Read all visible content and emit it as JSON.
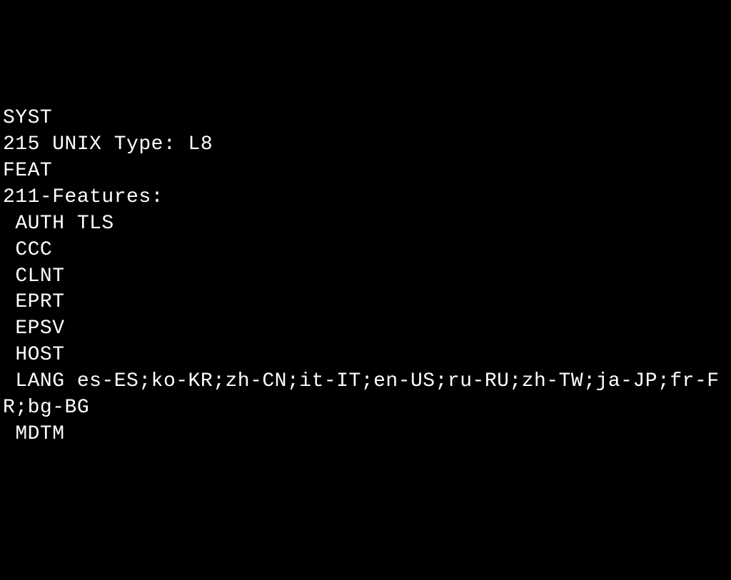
{
  "terminal": {
    "lines": [
      "SYST",
      "215 UNIX Type: L8",
      "FEAT",
      "211-Features:",
      " AUTH TLS",
      " CCC",
      " CLNT",
      " EPRT",
      " EPSV",
      " HOST",
      " LANG es-ES;ko-KR;zh-CN;it-IT;en-US;ru-RU;zh-TW;ja-JP;fr-FR;bg-BG",
      " MDTM"
    ]
  }
}
